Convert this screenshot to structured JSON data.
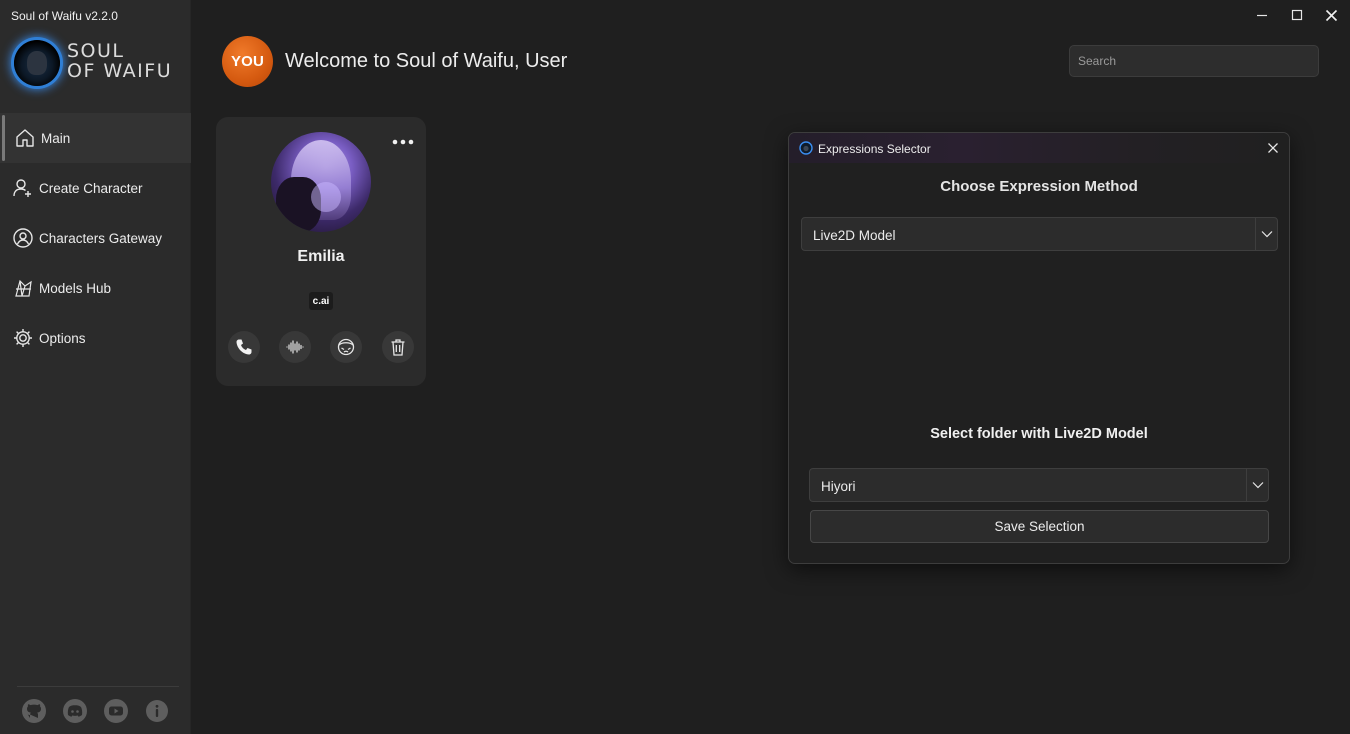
{
  "window": {
    "title": "Soul of Waifu v2.2.0"
  },
  "brand": {
    "logo_line1": "SOUL",
    "logo_line2": "OF WAIFU"
  },
  "sidebar": {
    "items": [
      {
        "label": "Main",
        "icon": "home-icon",
        "active": true
      },
      {
        "label": "Create Character",
        "icon": "user-plus-icon"
      },
      {
        "label": "Characters Gateway",
        "icon": "characters-gateway-icon"
      },
      {
        "label": "Models Hub",
        "icon": "models-hub-icon"
      },
      {
        "label": "Options",
        "icon": "gear-icon"
      }
    ],
    "social": [
      "github-icon",
      "discord-icon",
      "youtube-icon",
      "info-icon"
    ]
  },
  "header": {
    "avatar_text": "YOU",
    "welcome": "Welcome to Soul of Waifu, User",
    "search_placeholder": "Search"
  },
  "character_card": {
    "name": "Emilia",
    "source_badge": "c.ai",
    "actions": [
      "phone-icon",
      "voice-waveform-icon",
      "expression-icon",
      "trash-icon"
    ]
  },
  "dialog": {
    "title": "Expressions Selector",
    "heading": "Choose Expression Method",
    "method_value": "Live2D Model",
    "folder_heading": "Select folder with Live2D Model",
    "folder_value": "Hiyori",
    "save_label": "Save Selection"
  },
  "colors": {
    "accent_orange": "#d55a10",
    "logo_glow": "#3a8ef0",
    "background": "#1f1f1f",
    "sidebar": "#2b2b2b"
  }
}
